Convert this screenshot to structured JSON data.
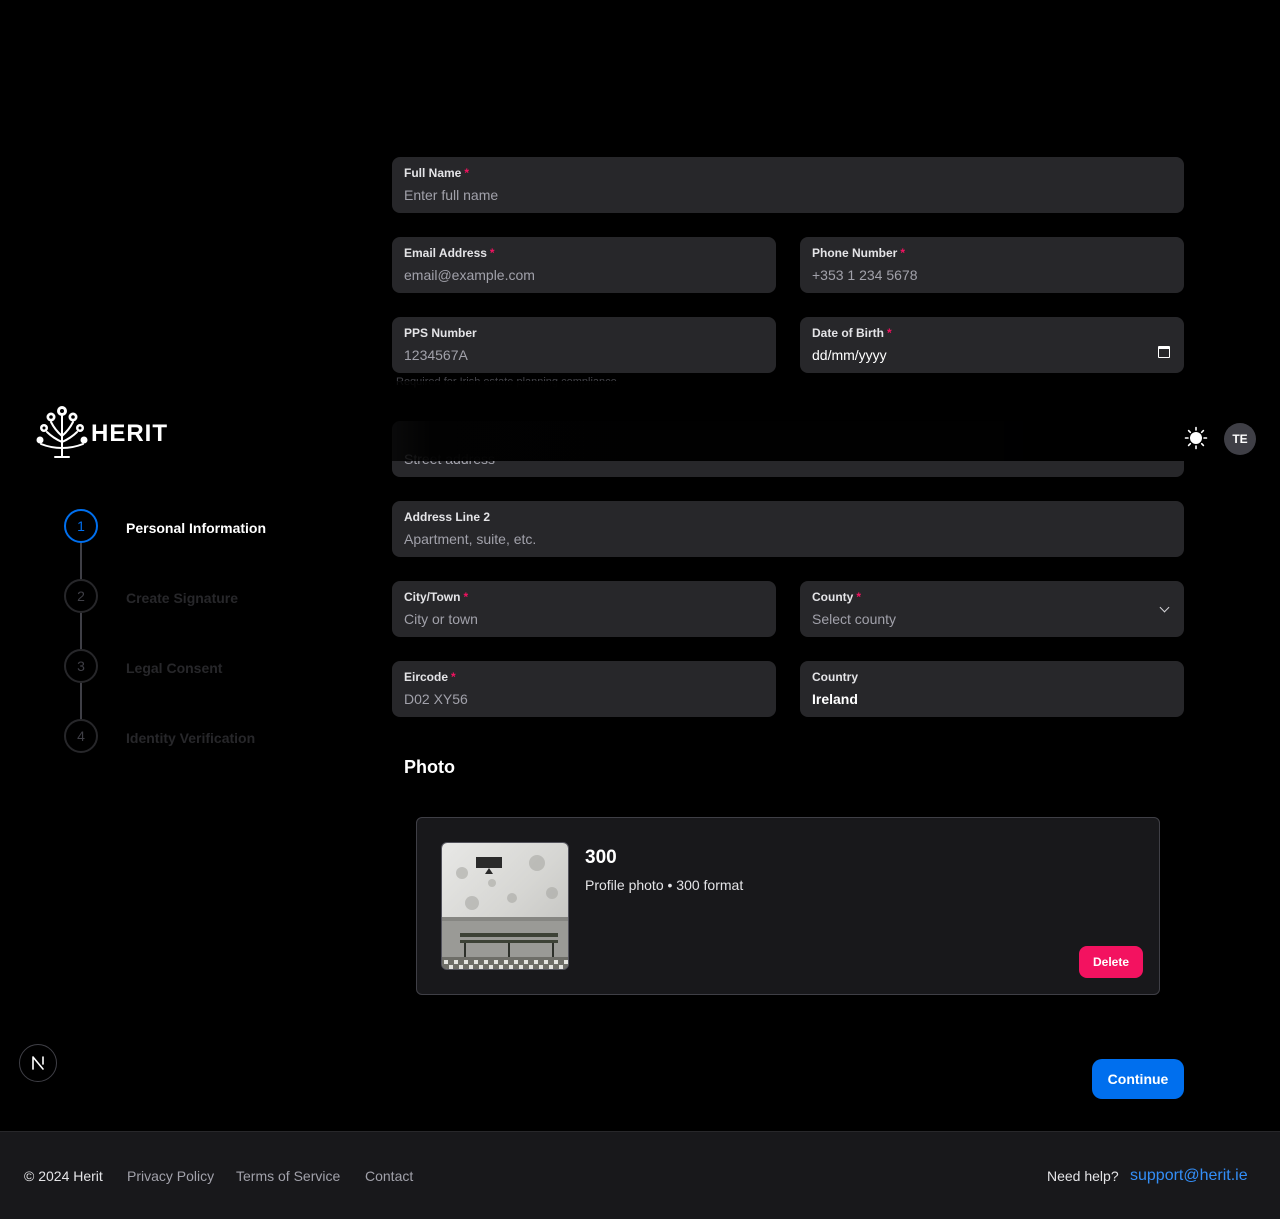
{
  "form": {
    "full_name": {
      "label": "Full Name",
      "placeholder": "Enter full name",
      "required": "*"
    },
    "email": {
      "label": "Email Address",
      "placeholder": "email@example.com",
      "required": "*"
    },
    "phone": {
      "label": "Phone Number",
      "placeholder": "+353 1 234 5678",
      "required": "*"
    },
    "pps": {
      "label": "PPS Number",
      "placeholder": "1234567A"
    },
    "dob": {
      "label": "Date of Birth",
      "value": "dd/mm/yyyy",
      "required": "*"
    },
    "pps_hint": "Required for Irish estate planning compliance",
    "address_line1": {
      "placeholder": "Street address"
    },
    "address_line2": {
      "label": "Address Line 2",
      "placeholder": "Apartment, suite, etc."
    },
    "city": {
      "label": "City/Town",
      "placeholder": "City or town",
      "required": "*"
    },
    "county": {
      "label": "County",
      "value": "Select county",
      "required": "*"
    },
    "eircode": {
      "label": "Eircode",
      "placeholder": "D02 XY56",
      "required": "*"
    },
    "country": {
      "label": "Country",
      "value": "Ireland"
    }
  },
  "header": {
    "logo_text": "HERIT",
    "avatar_initials": "TE",
    "theme_icon": "sun-icon"
  },
  "stepper": {
    "steps": [
      {
        "number": "1",
        "label": "Personal Information"
      },
      {
        "number": "2",
        "label": "Create Signature"
      },
      {
        "number": "3",
        "label": "Legal Consent"
      },
      {
        "number": "4",
        "label": "Identity Verification"
      }
    ],
    "active_step": 1
  },
  "photo": {
    "section_title": "Photo",
    "title": "300",
    "subtitle": "Profile photo • 300 format",
    "delete_label": "Delete"
  },
  "actions": {
    "continue_label": "Continue",
    "dev_badge_letter": "N"
  },
  "footer": {
    "copyright": "© 2024 Herit",
    "links": [
      "Privacy Policy",
      "Terms of Service",
      "Contact"
    ],
    "help_text": "Need help?",
    "support_email": "support@herit.ie"
  },
  "colors": {
    "primary": "#006fee",
    "danger": "#f31260",
    "field_bg": "#27272a",
    "link": "#338ef7"
  }
}
